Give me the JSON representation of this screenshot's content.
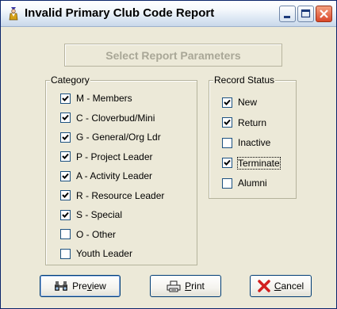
{
  "window": {
    "title": "Invalid Primary Club Code Report"
  },
  "banner": {
    "label": "Select Report Parameters"
  },
  "category": {
    "legend": "Category",
    "items": [
      {
        "label": "M - Members",
        "checked": true
      },
      {
        "label": "C - Cloverbud/Mini",
        "checked": true
      },
      {
        "label": "G - General/Org Ldr",
        "checked": true
      },
      {
        "label": "P - Project Leader",
        "checked": true
      },
      {
        "label": "A - Activity Leader",
        "checked": true
      },
      {
        "label": "R - Resource Leader",
        "checked": true
      },
      {
        "label": "S - Special",
        "checked": true
      },
      {
        "label": "O - Other",
        "checked": false
      },
      {
        "label": "Youth Leader",
        "checked": false
      }
    ]
  },
  "record_status": {
    "legend": "Record Status",
    "items": [
      {
        "label": "New",
        "checked": true
      },
      {
        "label": "Return",
        "checked": true
      },
      {
        "label": "Inactive",
        "checked": false
      },
      {
        "label": "Terminate",
        "checked": true
      },
      {
        "label": "Alumni",
        "checked": false
      }
    ]
  },
  "buttons": {
    "preview": {
      "pre": "Pre",
      "accel": "v",
      "post": "iew"
    },
    "print": {
      "pre": "",
      "accel": "P",
      "post": "rint"
    },
    "cancel": {
      "pre": "",
      "accel": "C",
      "post": "ancel"
    }
  },
  "icons": {
    "app": "wizard-figure-icon",
    "minimize": "minimize-icon",
    "maximize": "maximize-icon",
    "close": "close-icon",
    "preview": "binoculars-icon",
    "print": "printer-icon",
    "cancel": "red-x-icon"
  }
}
